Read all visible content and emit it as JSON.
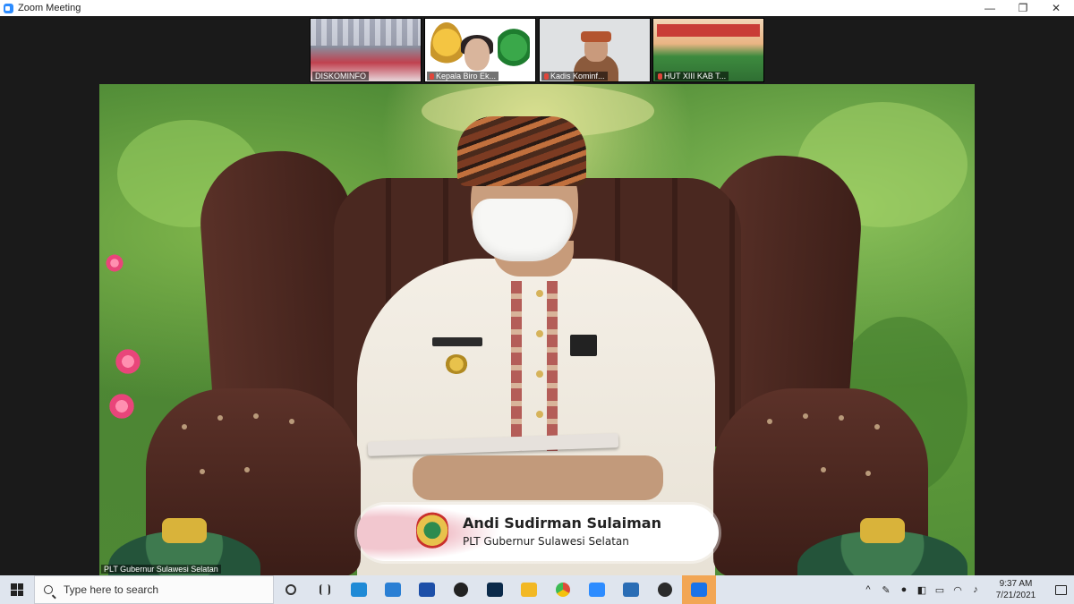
{
  "window": {
    "title": "Zoom Meeting",
    "controls": {
      "minimize": "—",
      "restore": "❐",
      "close": "✕"
    }
  },
  "thumbnails": [
    {
      "label": "DISKOMINFO",
      "muted": false
    },
    {
      "label": "Kepala Biro Ek...",
      "muted": true
    },
    {
      "label": "Kadis Kominf...",
      "muted": true
    },
    {
      "label": "HUT XIII KAB T...",
      "muted": true
    }
  ],
  "main_video": {
    "participant_caption": "PLT Gubernur Sulawesi Selatan",
    "namecard": {
      "name": "Andi Sudirman Sulaiman",
      "role": "PLT Gubernur Sulawesi Selatan"
    }
  },
  "taskbar": {
    "search_placeholder": "Type here to search",
    "apps": [
      {
        "icon": "task-view-icon",
        "color": "#333333"
      },
      {
        "icon": "multitask-icon",
        "color": "#333333"
      },
      {
        "icon": "edge-icon",
        "color": "#1f8ad6"
      },
      {
        "icon": "mail-icon",
        "color": "#2a7fd4"
      },
      {
        "icon": "blue-app-icon",
        "color": "#1d4fa8"
      },
      {
        "icon": "xbox-icon",
        "color": "#222222"
      },
      {
        "icon": "photoshop-icon",
        "color": "#0b2a4a"
      },
      {
        "icon": "file-explorer-icon",
        "color": "#f2b824"
      },
      {
        "icon": "chrome-icon",
        "color": "#dd4b39"
      },
      {
        "icon": "zoom-icon",
        "color": "#2d8cff"
      },
      {
        "icon": "photos-icon",
        "color": "#2a6db5"
      },
      {
        "icon": "obs-icon",
        "color": "#2b2b2b"
      },
      {
        "icon": "active-app-icon",
        "color": "#1a73e8"
      }
    ],
    "tray": {
      "icons": [
        "chevron-up-icon",
        "pen-icon",
        "mic-icon",
        "security-icon",
        "battery-icon",
        "wifi-icon",
        "volume-icon"
      ],
      "time": "9:37 AM",
      "date": "7/21/2021"
    }
  }
}
